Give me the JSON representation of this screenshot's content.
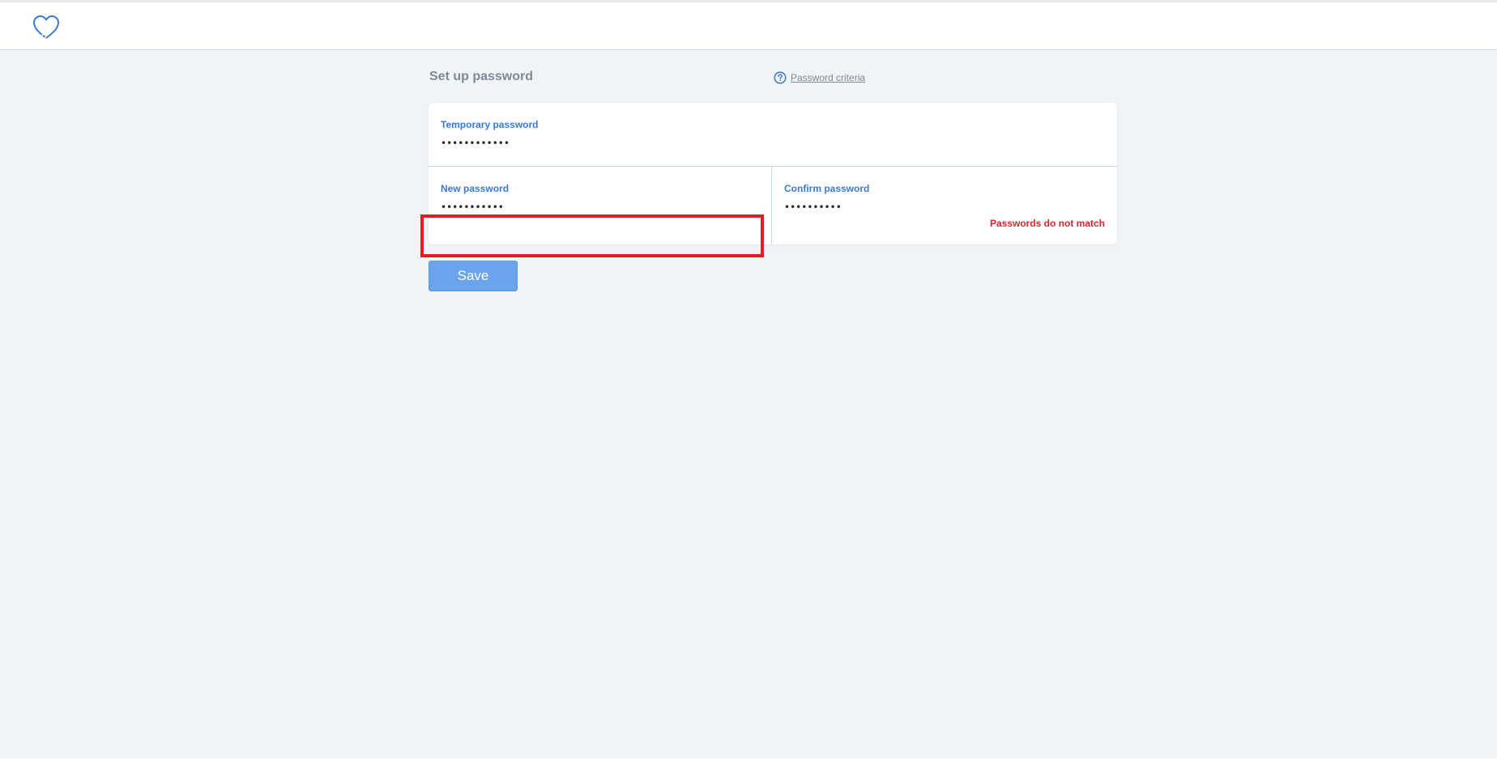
{
  "header": {
    "logo_icon": "heart-outline-icon",
    "accent_color": "#3a7bd5"
  },
  "page": {
    "title": "Set up password",
    "criteria_icon": "question-circle-icon",
    "criteria_link": "Password criteria"
  },
  "form": {
    "temporary": {
      "label": "Temporary password",
      "value": "••••••••••••"
    },
    "new": {
      "label": "New password",
      "value": "•••••••••••"
    },
    "confirm": {
      "label": "Confirm password",
      "value": "••••••••••",
      "error": "Passwords do not match",
      "error_color": "#e0262a"
    },
    "save_label": "Save"
  }
}
